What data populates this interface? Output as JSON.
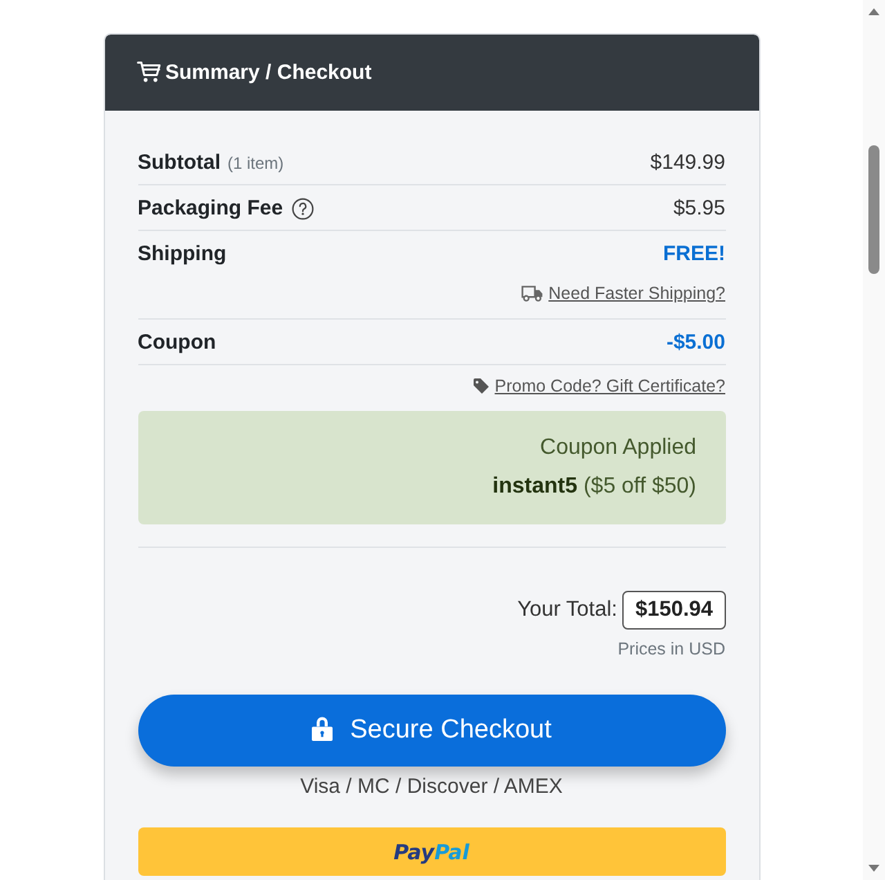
{
  "header": {
    "title": "Summary / Checkout"
  },
  "lines": [
    {
      "label": "Subtotal",
      "note": "(1 item)",
      "value": "$149.99",
      "highlighted": false,
      "help": false
    },
    {
      "label": "Packaging Fee",
      "value": "$5.95",
      "highlighted": false,
      "help": true
    },
    {
      "label": "Shipping",
      "value": "FREE!",
      "highlighted": true,
      "help": false,
      "link": {
        "text": "Need Faster Shipping?"
      }
    },
    {
      "label": "Coupon",
      "value": "-$5.00",
      "highlighted": true,
      "help": false
    }
  ],
  "promo_link": {
    "text": "Promo Code? Gift Certificate?"
  },
  "coupon_notice": {
    "title": "Coupon Applied",
    "detail": "**instant5** ($5 off $50)"
  },
  "total": {
    "label": "Your Total:",
    "value": "$150.94",
    "note": "Prices in USD"
  },
  "checkout_button": {
    "label": "Secure Checkout"
  },
  "payment_methods": "Visa / MC / Discover / AMEX",
  "paypal_button": {
    "logo": [
      {
        "text": "Pay",
        "color": "#253b80"
      },
      {
        "text": "Pal",
        "color": "#179bd7"
      }
    ]
  }
}
